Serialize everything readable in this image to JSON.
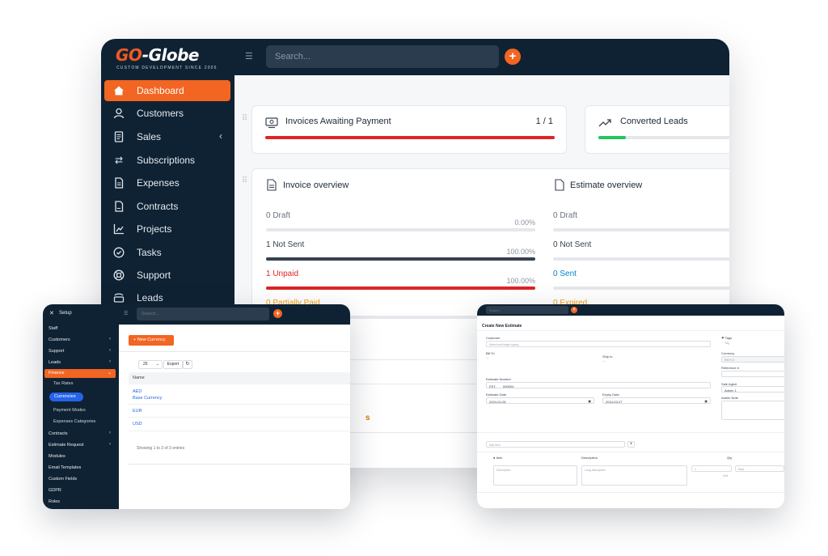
{
  "main": {
    "brand": {
      "name_prefix": "GO",
      "name_suffix": "-Globe",
      "tagline": "CUSTOM DEVELOPMENT SINCE 2005"
    },
    "search_placeholder": "Search...",
    "sidebar": [
      {
        "label": "Dashboard",
        "icon": "home-icon",
        "active": true
      },
      {
        "label": "Customers",
        "icon": "user-icon"
      },
      {
        "label": "Sales",
        "icon": "receipt-icon",
        "has_children": true
      },
      {
        "label": "Subscriptions",
        "icon": "repeat-icon"
      },
      {
        "label": "Expenses",
        "icon": "file-text-icon"
      },
      {
        "label": "Contracts",
        "icon": "contract-icon"
      },
      {
        "label": "Projects",
        "icon": "chart-icon"
      },
      {
        "label": "Tasks",
        "icon": "check-circle-icon"
      },
      {
        "label": "Support",
        "icon": "lifebuoy-icon"
      },
      {
        "label": "Leads",
        "icon": "tty-icon"
      }
    ],
    "widgets": {
      "invoices_awaiting": {
        "title": "Invoices Awaiting Payment",
        "count": "1 / 1",
        "progress": 1.0
      },
      "converted_leads": {
        "title": "Converted Leads",
        "progress": 0.2
      }
    },
    "invoice_overview": {
      "title": "Invoice overview",
      "rows": [
        {
          "label": "0 Draft",
          "pct": "0.00%",
          "progress": 0.0,
          "color": "#6b7280"
        },
        {
          "label": "1 Not Sent",
          "pct": "100.00%",
          "progress": 1.0,
          "color": "#374151"
        },
        {
          "label": "1 Unpaid",
          "pct": "100.00%",
          "progress": 1.0,
          "color": "#dc2626"
        },
        {
          "label": "0 Partially Paid",
          "pct": "",
          "progress": 0.0,
          "color": "#f59e0b"
        }
      ]
    },
    "estimate_overview": {
      "title": "Estimate overview",
      "rows": [
        {
          "label": "0 Draft",
          "color": "#6b7280"
        },
        {
          "label": "0 Not Sent",
          "color": "#374151"
        },
        {
          "label": "0 Sent",
          "color": "#0284c7"
        },
        {
          "label": "0 Expired",
          "color": "#f59e0b"
        }
      ]
    },
    "partial_text": "s"
  },
  "setup": {
    "title": "Setup",
    "search_placeholder": "Search...",
    "menu": [
      {
        "label": "Staff"
      },
      {
        "label": "Customers",
        "chevron": true
      },
      {
        "label": "Support",
        "chevron": true
      },
      {
        "label": "Leads",
        "chevron": true
      },
      {
        "label": "Finance",
        "chevron": true,
        "active": true
      },
      {
        "label": "Tax Rates",
        "sub": true
      },
      {
        "label": "Currencies",
        "sub": true,
        "selected": true
      },
      {
        "label": "Payment Modes",
        "sub": true
      },
      {
        "label": "Expenses Categories",
        "sub": true
      },
      {
        "label": "Contracts",
        "chevron": true
      },
      {
        "label": "Estimate Request",
        "chevron": true
      },
      {
        "label": "Modules"
      },
      {
        "label": "Email Templates"
      },
      {
        "label": "Custom Fields"
      },
      {
        "label": "GDPR"
      },
      {
        "label": "Roles"
      }
    ],
    "new_currency_label": "New Currency",
    "page_length": "25",
    "export_label": "Export",
    "table_header": "Name",
    "rows": [
      [
        "AED",
        "Base Currency"
      ],
      [
        "EUR"
      ],
      [
        "USD"
      ]
    ],
    "footer": "Showing 1 to 3 of 3 entries"
  },
  "estimate": {
    "search_placeholder": "Search...",
    "heading": "Create New Estimate",
    "customer_label": "Customer",
    "customer_placeholder": "Select and begin typing",
    "bill_to": "Bill To",
    "ship_to": "Ship to",
    "estimate_number_label": "Estimate Number",
    "estimate_prefix": "EST-",
    "estimate_number": "000004",
    "estimate_date_label": "Estimate Date",
    "estimate_date": "2024-02-28",
    "expiry_date_label": "Expiry Date",
    "expiry_date": "2024-03-27",
    "tags_label": "Tags",
    "tag_placeholder": "Tag",
    "currency_label": "Currency",
    "currency_value": "RM R.S",
    "reference_label": "Reference #",
    "sale_agent_label": "Sale Agent",
    "sale_agent_value": "Admin 1",
    "admin_note_label": "Admin Note",
    "add_item_placeholder": "Add Item",
    "col_item": "Item",
    "col_description": "Description",
    "col_qty": "Qty",
    "description_placeholder": "Description",
    "long_description_placeholder": "Long description",
    "qty_value": "1",
    "unit_label": "Unit",
    "rate_placeholder": "Rate"
  }
}
